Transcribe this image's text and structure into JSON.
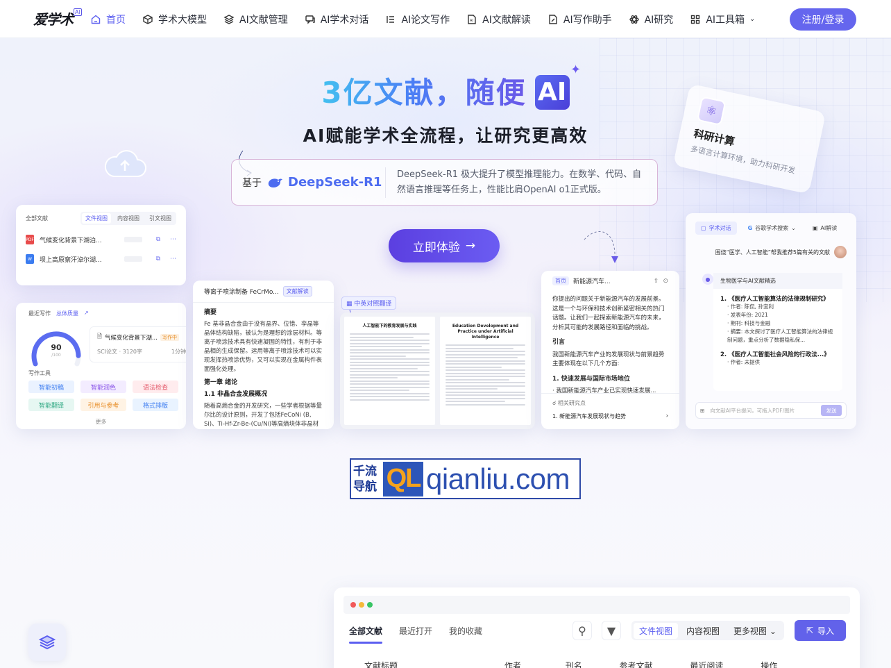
{
  "nav": {
    "logo": "爱学术",
    "logo_badge": "AI",
    "items": [
      {
        "label": "首页",
        "icon": "home-icon",
        "active": true
      },
      {
        "label": "学术大模型",
        "icon": "cube-icon"
      },
      {
        "label": "AI文献管理",
        "icon": "layers-icon"
      },
      {
        "label": "AI学术对话",
        "icon": "chat-icon"
      },
      {
        "label": "AI论文写作",
        "icon": "list-icon"
      },
      {
        "label": "AI文献解读",
        "icon": "ai-doc-icon"
      },
      {
        "label": "AI写作助手",
        "icon": "edit-doc-icon"
      },
      {
        "label": "AI研究",
        "icon": "atom-icon"
      },
      {
        "label": "AI工具箱",
        "icon": "grid-icon"
      }
    ],
    "login": "注册/登录"
  },
  "hero": {
    "title": "3亿文献，随便",
    "title_badge": "AI",
    "subtitle": "AI赋能学术全流程，让研究更高效",
    "based_on": "基于",
    "model_name": "DeepSeek-R1",
    "model_desc": "DeepSeek-R1 极大提升了模型推理能力。在数学、代码、自然语言推理等任务上，性能比肩OpenAI o1正式版。",
    "cta": "立即体验"
  },
  "science_card": {
    "title": "科研计算",
    "subtitle": "多语言计算环境，助力科研开发"
  },
  "card_files": {
    "title": "全部文献",
    "tabs": [
      "文件视图",
      "内容视图",
      "引文视图"
    ],
    "rows": [
      {
        "type": "PDF",
        "name": "气候变化背景下湖泊..."
      },
      {
        "type": "W",
        "name": "坝上高原察汗淖尔湖..."
      }
    ]
  },
  "card_writing": {
    "title": "最近写作",
    "quality": "总体质量",
    "score": "90",
    "score_max": "/100",
    "doc_name": "气候变化背景下湖...",
    "doc_status": "写作中",
    "doc_meta": "SCI论文 · 3120字",
    "doc_time": "1分钟",
    "tools_title": "写作工具",
    "tools": [
      "智能初稿",
      "智能润色",
      "语法检查",
      "智能翻译",
      "引用与参考",
      "格式排版"
    ],
    "more": "更多"
  },
  "card_reading": {
    "title": "等离子喷涂制备 FeCrMo...",
    "tag": "文献解读",
    "abstract_h": "摘要",
    "abstract": "Fe 基非晶合金由于没有晶界、位错、孪晶等晶体结构缺陷，被认为是理想的涂层材料。等离子喷涂技术具有快速凝固的特性，有利于非晶相的生成保留。运用等离子喷涂技术可以实现发挥热喷涂优势，又可以实现在金属构件表面强化处理。",
    "chapter": "第一章 绪论",
    "section": "1.1 非晶合金发展概况",
    "section_text": "随着高熵合金的开发研究，一些学者根据等量尔比的设计原则，开发了包括FeCoNi (B, Si)、Ti-Hf-Zr-Be-(Cu/Ni)等高熵块体非晶材料......"
  },
  "card_translate": {
    "tag": "中英对照翻译",
    "left_title": "人工智能下的教育发展与实践",
    "right_title": "Education Development and Practice under Artificial Intelligence"
  },
  "card_ev": {
    "tab": "首页",
    "title": "新能源汽车...",
    "intro": "你提出的问题关于新能源汽车的发展前景。这是一个与环保和技术创新紧密相关的热门话题。让我们一起探索新能源汽车的未来，分析其可能的发展路径和面临的挑战。",
    "h": "引言",
    "text": "我国新能源汽车产业的发展现状与前景趋势主要体现在以下几个方面:",
    "point": "1. 快速发展与国际市场地位",
    "bullet": "· 我国新能源汽车产业已实现快速发展...",
    "related": "相关研究点",
    "related_item": "1. 新能源汽车发展现状与趋势"
  },
  "card_chat": {
    "tabs": [
      "学术对话",
      "谷歌学术搜索",
      "AI解读"
    ],
    "question": "围绕“医学、人工智能”帮我推荐5篇有关的文献",
    "answer_header": "生物医学与AI文献精选",
    "item1": "1. 《医疗人工智能算法的法律规制研究》",
    "item1_lines": [
      "· 作者: 陈侃, 孙宜利",
      "· 发表年份: 2021",
      "· 期刊: 科技与金融",
      "· 摘要: 本文探讨了医疗人工智能算法的法律规制问题，重点分析了数据隐私保..."
    ],
    "item2": "2. 《医疗人工智能社会风险的行政法...》",
    "item2_lines": [
      "· 作者: 未提供"
    ],
    "input_placeholder": "向文献AI平台提问，可拖入PDF/图片",
    "send": "发送"
  },
  "watermark": {
    "cn": "千流导航",
    "ql": "QL",
    "url": "qianliu.com"
  },
  "app": {
    "tabs": [
      "全部文献",
      "最近打开",
      "我的收藏"
    ],
    "views": [
      "文件视图",
      "内容视图",
      "更多视图"
    ],
    "import": "导入",
    "columns": [
      "文献标题",
      "作者",
      "刊名",
      "参考文献",
      "最近阅读",
      "操作"
    ]
  },
  "colors": {
    "accent": "#5b5ef0",
    "login_bg": "#6566ee",
    "cta_bg": "#5b3fe0"
  }
}
